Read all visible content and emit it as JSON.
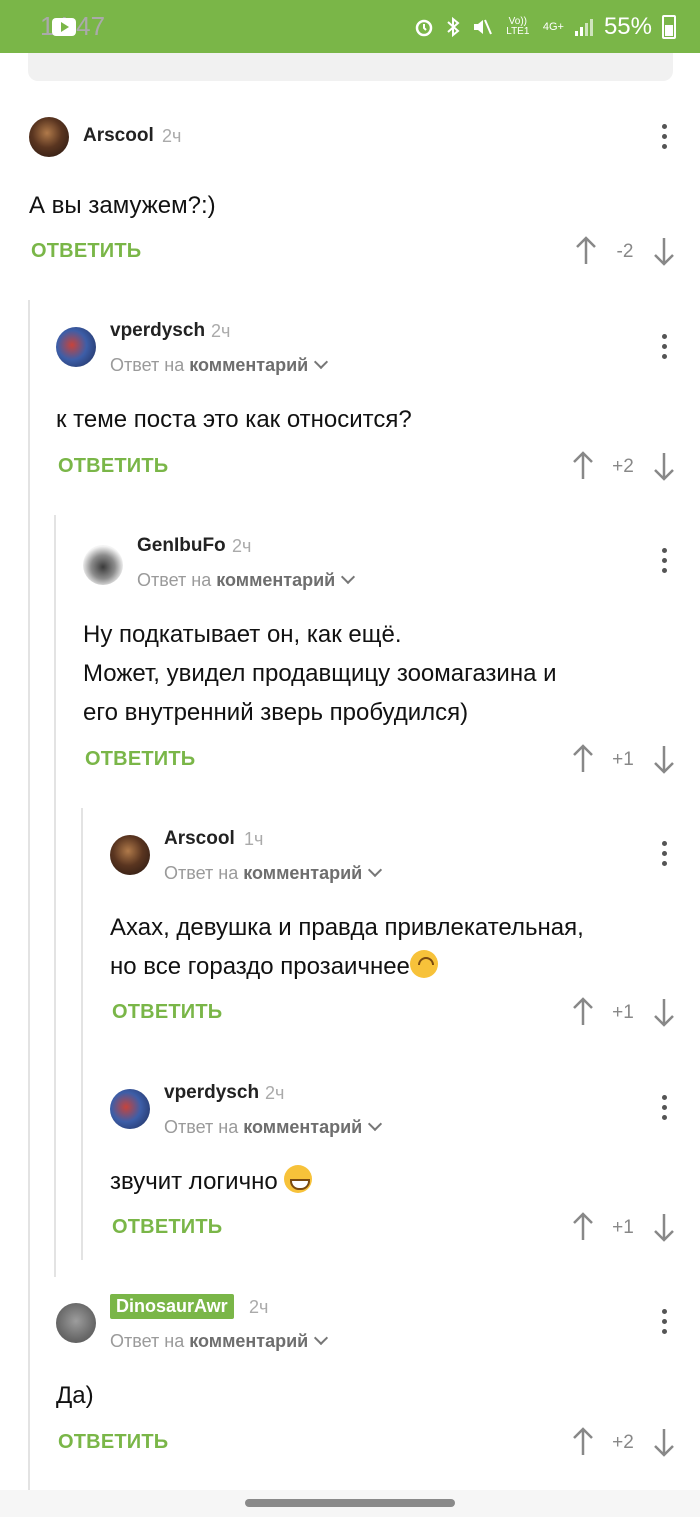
{
  "status_bar": {
    "time": "14:47",
    "battery": "55%",
    "icons": [
      "youtube-icon",
      "alarm-icon",
      "bluetooth-icon",
      "mute-icon",
      "volte-icon",
      "4g-icon",
      "signal-icon",
      "battery-icon"
    ],
    "network_label": "Vo)) LTE1",
    "data_label": "4G+"
  },
  "colors": {
    "accent": "#7ab648",
    "background": "#ffffff",
    "muted": "#9a9a9a"
  },
  "ui": {
    "reply_label": "ОТВЕТИТЬ",
    "reply_to_prefix": "Ответ на",
    "reply_to_target": "комментарий"
  },
  "comments": [
    {
      "author": "Arscool",
      "time": "2ч",
      "text": [
        "А вы замужем?:)"
      ],
      "score": "-2",
      "reply_to": false
    },
    {
      "author": "vperdysch",
      "time": "2ч",
      "text": [
        "к теме поста это как относится?"
      ],
      "score": "+2",
      "reply_to": true
    },
    {
      "author": "GenIbuFo",
      "time": "2ч",
      "text": [
        "Ну подкатывает он, как ещё.",
        "Может, увидел продавщицу зоомагазина и",
        "его внутренний зверь пробудился)"
      ],
      "score": "+1",
      "reply_to": true
    },
    {
      "author": "Arscool",
      "time": "1ч",
      "text": [
        "Ахах, девушка и правда привлекательная,",
        "но все гораздо прозаичнее"
      ],
      "score": "+1",
      "reply_to": true,
      "emoji": "upside-down-face-emoji"
    },
    {
      "author": "vperdysch",
      "time": "2ч",
      "text": [
        "звучит логично "
      ],
      "score": "+1",
      "reply_to": true,
      "emoji": "grinning-face-emoji"
    },
    {
      "author": "DinosaurAwr",
      "time": "2ч",
      "text": [
        "Да)"
      ],
      "score": "+2",
      "reply_to": true,
      "author_badge": true
    }
  ]
}
